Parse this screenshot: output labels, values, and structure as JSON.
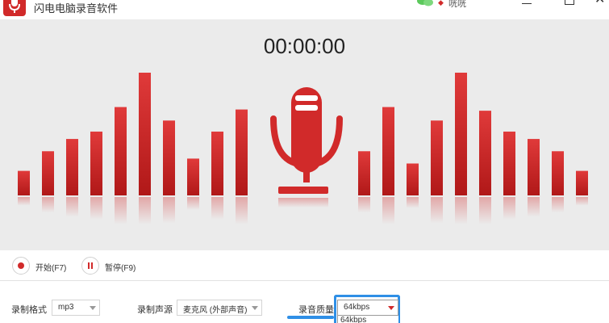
{
  "window": {
    "title": "闪电电脑录音软件",
    "user_name": "咣咣"
  },
  "recorder": {
    "timer": "00:00:00",
    "level_bars": {
      "left": [
        0.2,
        0.36,
        0.46,
        0.52,
        0.72,
        1.0,
        0.61,
        0.3,
        0.52,
        0.7
      ],
      "right": [
        0.36,
        0.72,
        0.26,
        0.61,
        1.0,
        0.69,
        0.52,
        0.46,
        0.36,
        0.2
      ]
    },
    "accent_color": "#d12a2a"
  },
  "controls": {
    "start_label": "开始(F7)",
    "pause_label": "暂停(F9)"
  },
  "settings": {
    "format_label": "录制格式",
    "format_value": "mp3",
    "source_label": "录制声源",
    "source_value": "麦克风 (外部声音)",
    "quality_label": "录音质量",
    "quality_value": "64kbps",
    "quality_option": "64kbps"
  },
  "icons": {
    "logo": "microphone-icon",
    "wechat": "wechat-icon",
    "user": "gem-icon",
    "minimize": "minimize-icon",
    "maximize": "maximize-icon",
    "close": "close-icon"
  }
}
